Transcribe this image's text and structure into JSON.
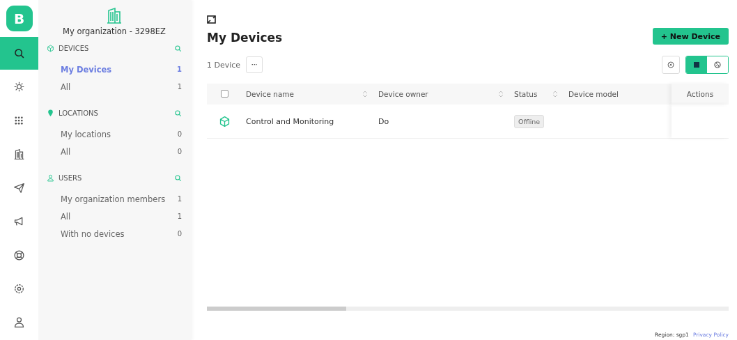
{
  "logo": {
    "letter": "B"
  },
  "rail": [
    {
      "selected": true
    },
    {
      "selected": false
    },
    {
      "selected": false
    },
    {
      "selected": false
    },
    {
      "selected": false
    },
    {
      "selected": false
    },
    {
      "selected": false
    },
    {
      "selected": false
    },
    {
      "selected": false
    }
  ],
  "sidebar": {
    "organization": "My organization - 3298EZ",
    "sections": [
      {
        "title": "DEVICES",
        "items": [
          {
            "label": "My Devices",
            "count": "1",
            "selected": true
          },
          {
            "label": "All",
            "count": "1",
            "selected": false
          }
        ]
      },
      {
        "title": "LOCATIONS",
        "items": [
          {
            "label": "My locations",
            "count": "0",
            "selected": false
          },
          {
            "label": "All",
            "count": "0",
            "selected": false
          }
        ]
      },
      {
        "title": "USERS",
        "items": [
          {
            "label": "My organization members",
            "count": "1",
            "selected": false
          },
          {
            "label": "All",
            "count": "1",
            "selected": false
          },
          {
            "label": "With no devices",
            "count": "0",
            "selected": false
          }
        ]
      }
    ]
  },
  "page": {
    "title": "My Devices",
    "count": "1 Device",
    "more": "···",
    "new_button": "+ New Device",
    "views": [
      {
        "selected": true
      },
      {
        "selected": false
      }
    ]
  },
  "table": {
    "columns": [
      "Device name",
      "Device owner",
      "Status",
      "Device model",
      "Actions"
    ],
    "select_all": {
      "checked": false
    },
    "rows": [
      {
        "name": "Control and Monitoring",
        "owner": "Do",
        "status": "Offline"
      }
    ]
  },
  "footer": {
    "region": "Region: sgp1",
    "link": "Privacy Policy"
  }
}
